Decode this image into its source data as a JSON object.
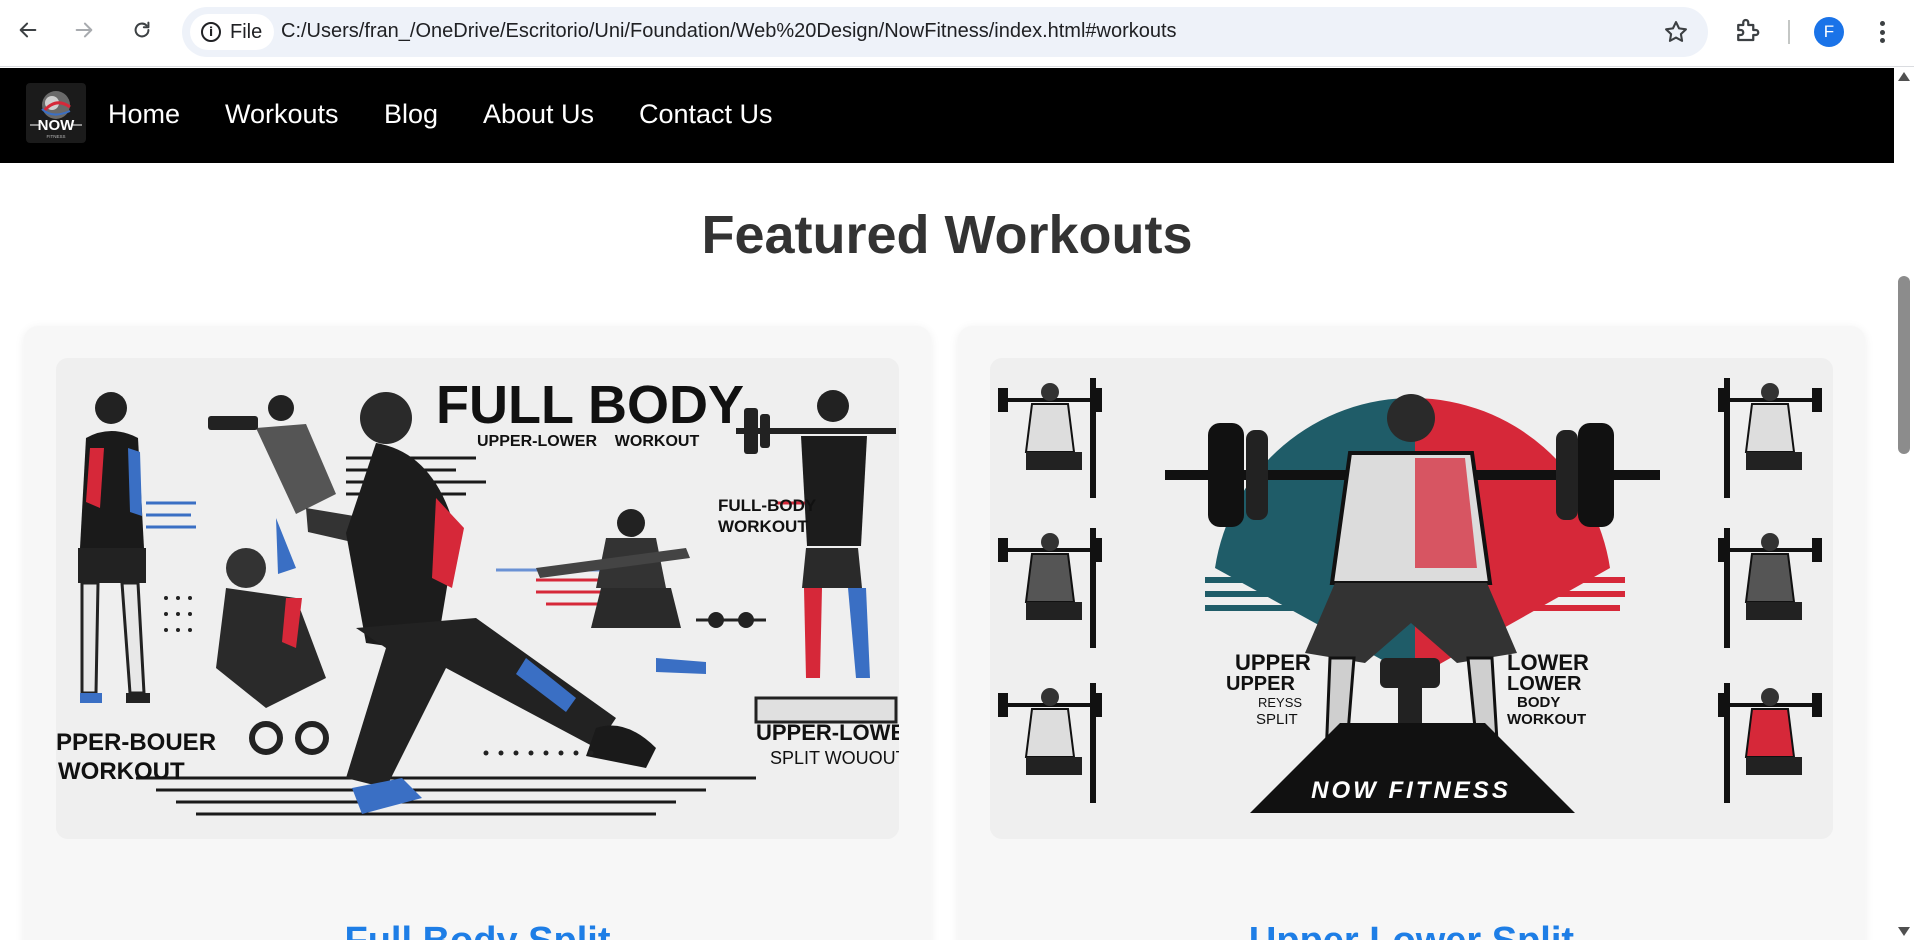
{
  "browser": {
    "site_chip_label": "File",
    "url": "C:/Users/fran_/OneDrive/Escritorio/Uni/Foundation/Web%20Design/NowFitness/index.html#workouts",
    "profile_initial": "F"
  },
  "nav": {
    "logo_text": "NOW",
    "logo_subtext": "FITNESS",
    "links": [
      "Home",
      "Workouts",
      "Blog",
      "About Us",
      "Contact Us"
    ]
  },
  "section": {
    "title": "Featured Workouts"
  },
  "cards": [
    {
      "title": "Full Body Split",
      "image_texts": {
        "heading": "FULL BODY",
        "subheading": "UPPER-LOWER    WORKOUT",
        "side_label_1": "FULL-BODY",
        "side_label_2": "WORKOUT",
        "bottom_left_1": "PPER-BOUER",
        "bottom_left_2": "WORKOUT",
        "bottom_right_1": "UPPER-LOWE",
        "bottom_right_2": "SPLIT WOUOUT"
      }
    },
    {
      "title": "Upper Lower Split",
      "image_texts": {
        "left_1": "UPPER",
        "left_2": "UPPER",
        "left_3": "REYSS",
        "left_4": "SPLIT",
        "right_1": "LOWER",
        "right_2": "LOWER",
        "right_3": "BODY",
        "right_4": "WORKOUT",
        "banner": "NOW FITNESS"
      }
    }
  ],
  "colors": {
    "nav_bg": "#000000",
    "title_text": "#333333",
    "card_title": "#1e7ee6",
    "card_bg": "#f7f7f7",
    "accent_red": "#d62839",
    "accent_blue": "#3a6fc4",
    "accent_teal": "#1f5c68"
  }
}
